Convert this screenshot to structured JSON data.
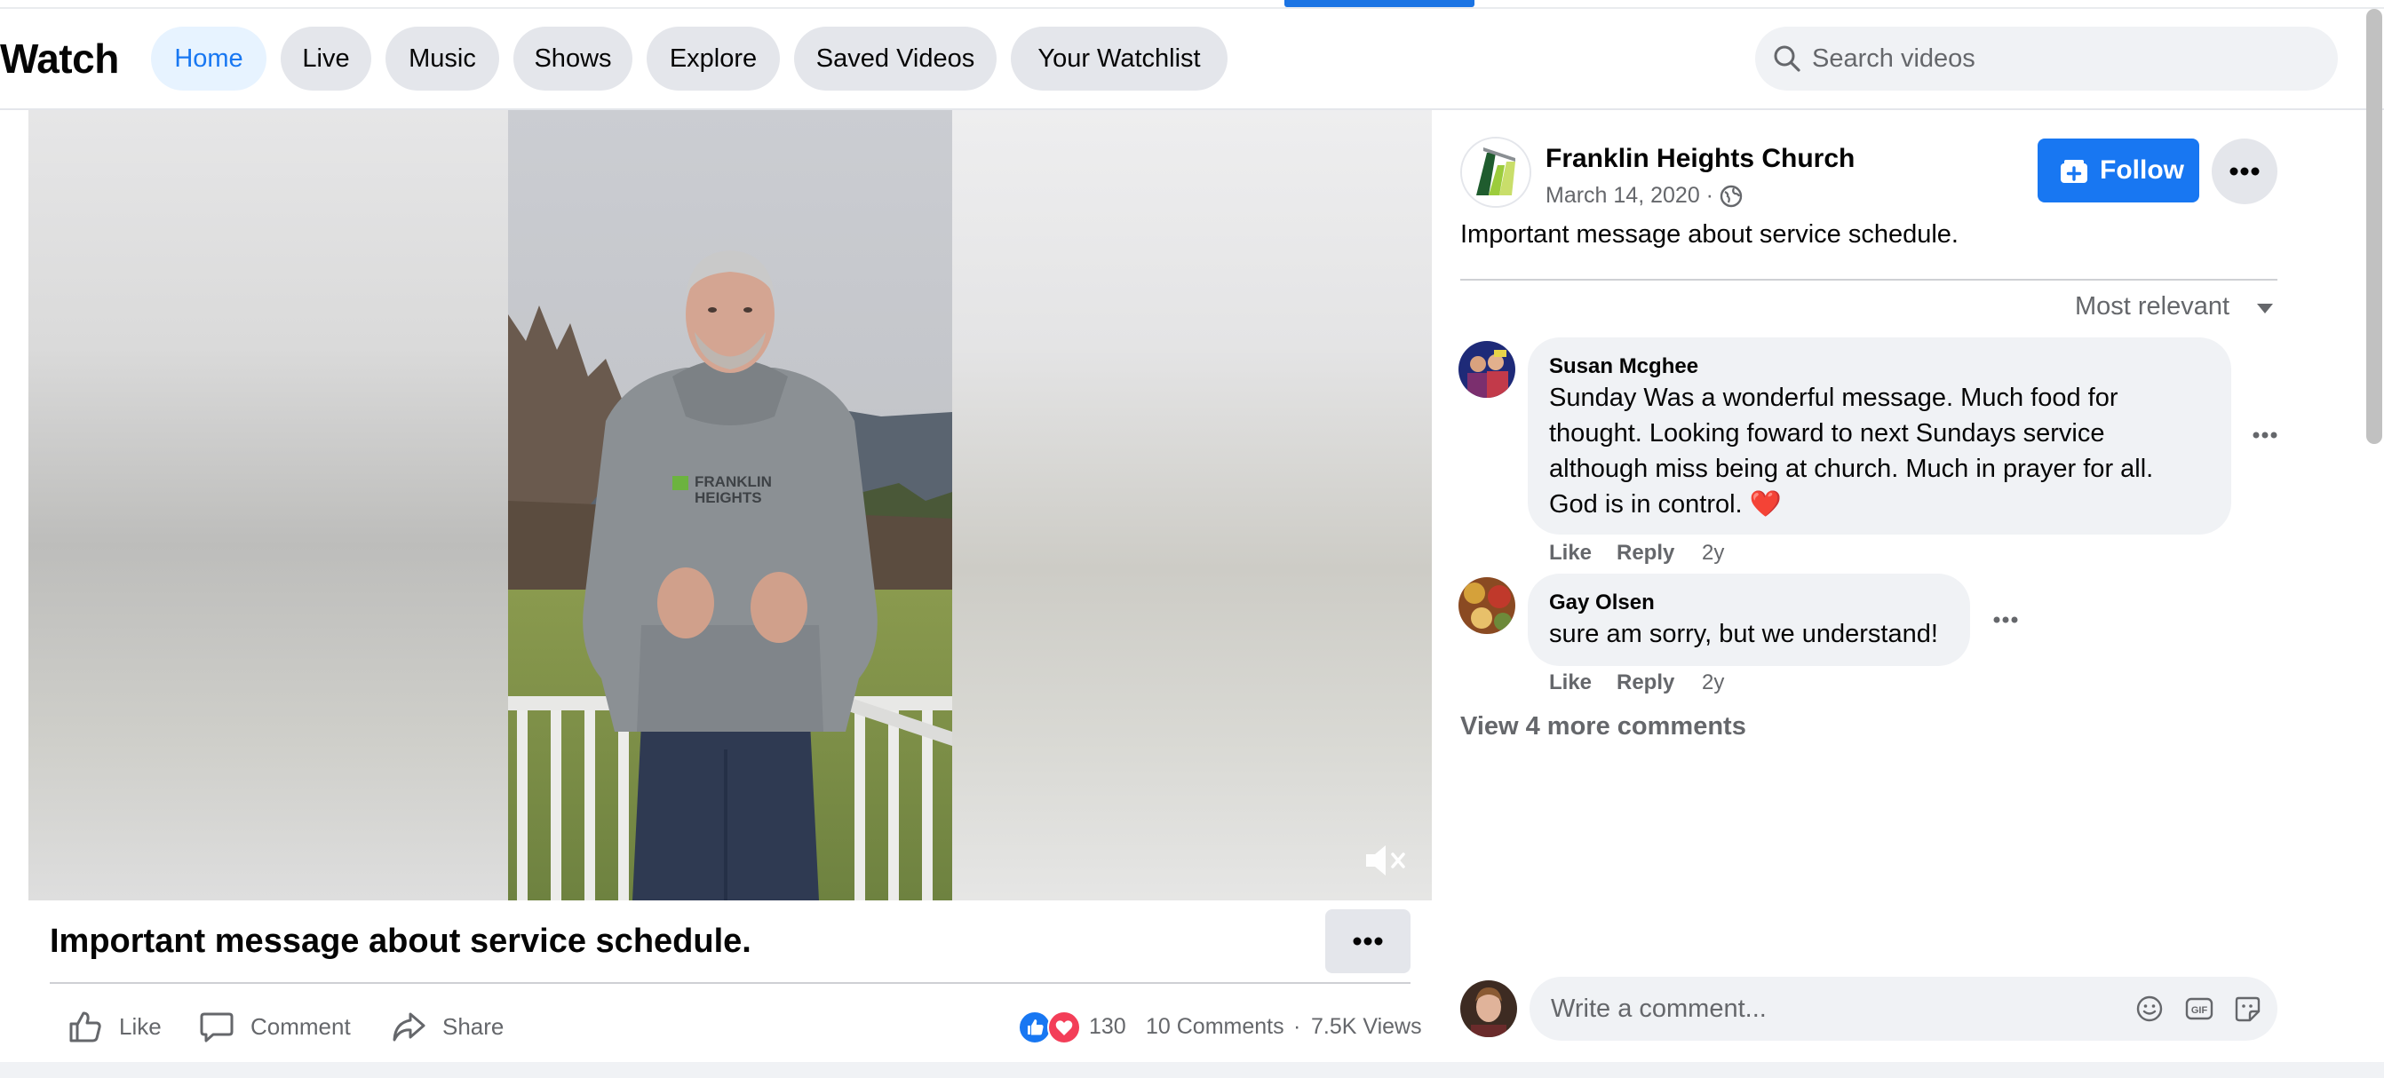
{
  "nav": {
    "title": "Watch",
    "tabs": [
      {
        "label": "Home",
        "active": true
      },
      {
        "label": "Live"
      },
      {
        "label": "Music"
      },
      {
        "label": "Shows"
      },
      {
        "label": "Explore"
      },
      {
        "label": "Saved Videos"
      },
      {
        "label": "Your Watchlist"
      }
    ],
    "search_placeholder": "Search videos"
  },
  "video": {
    "title": "Important message about service schedule.",
    "muted": true,
    "sweatshirt_text_1": "FRANKLIN",
    "sweatshirt_text_2": "HEIGHTS"
  },
  "actions": {
    "like": "Like",
    "comment": "Comment",
    "share": "Share"
  },
  "stats": {
    "reactions": "130",
    "comments": "10 Comments",
    "separator": "·",
    "views": "7.5K Views"
  },
  "post": {
    "page_name": "Franklin Heights Church",
    "date": "March 14, 2020 ·",
    "follow_label": "Follow",
    "description": "Important message about service schedule."
  },
  "comments_section": {
    "sort_label": "Most relevant",
    "view_more": "View 4 more comments",
    "input_placeholder": "Write a comment...",
    "items": [
      {
        "author": "Susan Mcghee",
        "lines": [
          "Sunday Was a wonderful message. Much food for",
          "thought. Looking foward to next Sundays service",
          "although miss being at church. Much in prayer for all.",
          "God is in control. ❤️"
        ],
        "like": "Like",
        "reply": "Reply",
        "time": "2y"
      },
      {
        "author": "Gay Olsen",
        "lines": [
          "sure am sorry, but we understand!"
        ],
        "like": "Like",
        "reply": "Reply",
        "time": "2y"
      }
    ]
  },
  "colors": {
    "accent": "#1877f2",
    "text_secondary": "#65676b",
    "bubble": "#f0f2f5",
    "pill": "#e4e6eb"
  }
}
